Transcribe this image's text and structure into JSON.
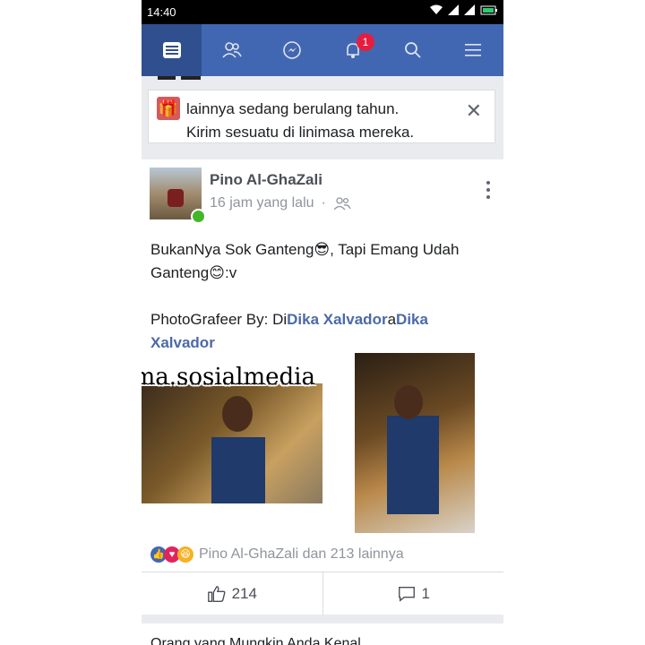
{
  "status_bar": {
    "time": "14:40"
  },
  "nav": {
    "items": [
      {
        "icon": "news-feed-icon",
        "active": true
      },
      {
        "icon": "friends-icon",
        "active": false
      },
      {
        "icon": "messenger-icon",
        "active": false
      },
      {
        "icon": "notifications-icon",
        "active": false,
        "badge": "1"
      },
      {
        "icon": "search-icon",
        "active": false
      },
      {
        "icon": "menu-icon",
        "active": false
      }
    ]
  },
  "birthday_reminder": {
    "line1": "lainnya sedang berulang tahun.",
    "line2": "Kirim sesuatu di linimasa mereka."
  },
  "post": {
    "author": "Pino Al-GhaZali",
    "time": "16 jam yang lalu",
    "separator": "·",
    "text_line1_before": "BukanNya Sok Ganteng",
    "emoji1": "😎",
    "text_line1_after": ", Tapi Emang Udah",
    "text_line2_before": "Ganteng",
    "emoji2": "😊",
    "text_line2_after": ":v",
    "credit_prefix": "PhotoGrafeer By: Di",
    "credit_link1": "Dika Xalvador",
    "credit_middle": "a",
    "credit_link2": "Dika Xalvador",
    "reactions_text": "Pino Al-GhaZali dan 213 lainnya",
    "like_count": "214",
    "comment_count": "1"
  },
  "watermark": "@drama.sosialmedia",
  "next_card_text": "Orang yang Mungkin Anda Kenal",
  "colors": {
    "brand": "#4267b2",
    "link": "#4b6aa8",
    "badge": "#e41e3f",
    "online": "#42b72a"
  }
}
